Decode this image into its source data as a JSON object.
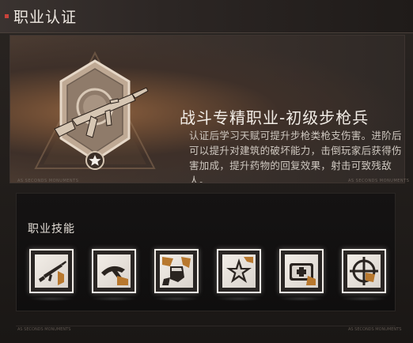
{
  "window": {
    "title": "职业认证"
  },
  "role": {
    "name": "战斗专精职业-初级步枪兵",
    "description": "认证后学习天赋可提升步枪类枪支伤害。进阶后可以提升对建筑的破坏能力，击倒玩家后获得伤害加成，提升药物的回复效果，射击可致残敌人。",
    "badge_icon": "rifle-badge-icon",
    "captions": {
      "left": "AS SECONDS MONUMENTS",
      "right": "AS SECONDS MONUMENTS"
    }
  },
  "skills": {
    "heading": "职业技能",
    "items": [
      {
        "icon": "rifle-skill-icon"
      },
      {
        "icon": "axe-skill-icon"
      },
      {
        "icon": "fist-rubble-skill-icon"
      },
      {
        "icon": "star-burst-skill-icon"
      },
      {
        "icon": "medkit-skill-icon"
      },
      {
        "icon": "crosshair-skill-icon"
      }
    ],
    "captions": {
      "left": "AS SECONDS MONUMENTS",
      "right": "AS SECONDS MONUMENTS"
    }
  },
  "colors": {
    "accent_red": "#c9423a",
    "hero_glow": "#8a5f3e",
    "skill_border": "#f1ece6"
  }
}
